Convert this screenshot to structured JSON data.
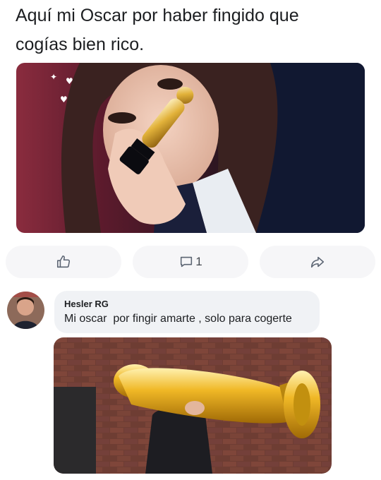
{
  "post": {
    "text_line1": "Aquí mi Oscar por haber fingido que",
    "text_line2": "cogías bien rico."
  },
  "actions": {
    "like_icon": "thumbs-up-icon",
    "comment_icon": "comment-icon",
    "comment_count": "1",
    "share_icon": "share-arrow-icon"
  },
  "comment": {
    "author": "Hesler RG",
    "text": "Mi oscar  por fingir amarte , solo para cogerte"
  },
  "colors": {
    "text": "#1c1e21",
    "action_bg": "#f6f6f8",
    "bubble_bg": "#f0f2f5",
    "icon": "#5b6472",
    "gold": "#d9a21b"
  }
}
